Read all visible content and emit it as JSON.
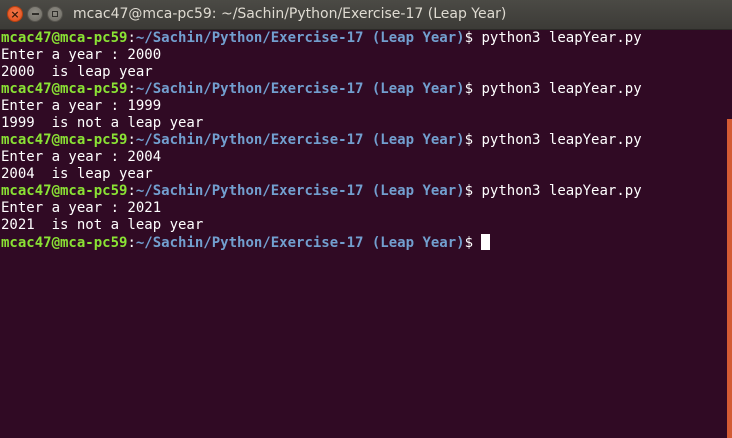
{
  "window": {
    "title": "mcac47@mca-pc59: ~/Sachin/Python/Exercise-17 (Leap Year)",
    "close_glyph": "×"
  },
  "terminal": {
    "lines": [
      {
        "type": "prompt",
        "user": "mcac47@mca-pc59",
        "sep": ":",
        "path": "~/Sachin/Python/Exercise-17 (Leap Year)",
        "dollar": "$",
        "command": " python3 leapYear.py"
      },
      {
        "type": "output",
        "text": "Enter a year : 2000"
      },
      {
        "type": "output",
        "text": "2000  is leap year"
      },
      {
        "type": "prompt",
        "user": "mcac47@mca-pc59",
        "sep": ":",
        "path": "~/Sachin/Python/Exercise-17 (Leap Year)",
        "dollar": "$",
        "command": " python3 leapYear.py"
      },
      {
        "type": "output",
        "text": "Enter a year : 1999"
      },
      {
        "type": "output",
        "text": "1999  is not a leap year"
      },
      {
        "type": "prompt",
        "user": "mcac47@mca-pc59",
        "sep": ":",
        "path": "~/Sachin/Python/Exercise-17 (Leap Year)",
        "dollar": "$",
        "command": " python3 leapYear.py"
      },
      {
        "type": "output",
        "text": "Enter a year : 2004"
      },
      {
        "type": "output",
        "text": "2004  is leap year"
      },
      {
        "type": "prompt",
        "user": "mcac47@mca-pc59",
        "sep": ":",
        "path": "~/Sachin/Python/Exercise-17 (Leap Year)",
        "dollar": "$",
        "command": " python3 leapYear.py"
      },
      {
        "type": "output",
        "text": "Enter a year : 2021"
      },
      {
        "type": "output",
        "text": "2021  is not a leap year"
      },
      {
        "type": "prompt",
        "user": "mcac47@mca-pc59",
        "sep": ":",
        "path": "~/Sachin/Python/Exercise-17 (Leap Year)",
        "dollar": "$",
        "command": " ",
        "cursor": true
      }
    ]
  },
  "colors": {
    "background": "#300a24",
    "user": "#8ae234",
    "path": "#729fcf",
    "text": "#ffffff",
    "scrollbar": "#d35b34"
  }
}
